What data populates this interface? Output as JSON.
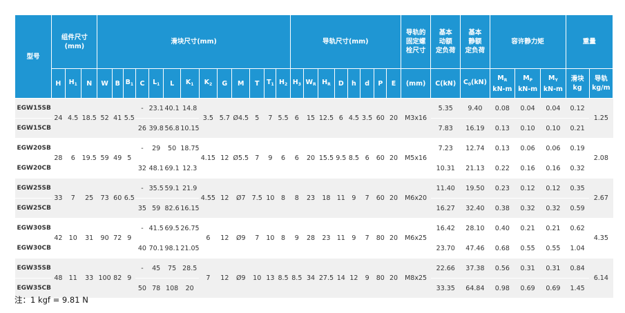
{
  "headers": {
    "model": "型号",
    "assembly": "组件尺寸\n(mm)",
    "block": "滑块尺寸(mm)",
    "rail": "导轨尺寸(mm)",
    "bolt": "导轨的\n固定螺\n栓尺寸",
    "dyn": "基本\n动额\n定负荷",
    "stat": "基本\n静额\n定负荷",
    "moment": "容许静力矩",
    "weight": "重量",
    "mm": "(mm)",
    "c_unit": "C(kN)",
    "c0_unit": "C0(kN)",
    "mr": "MR",
    "mp": "MP",
    "my": "MY",
    "slider": "滑块",
    "railw": "导轨",
    "knm": "kN-m",
    "kg": "kg",
    "kgm": "kg/m"
  },
  "dims": [
    "H",
    "H1",
    "N",
    "W",
    "B",
    "B1",
    "C",
    "L1",
    "L",
    "K1",
    "K2",
    "G",
    "M",
    "T",
    "T1",
    "H2",
    "H3",
    "WR",
    "HR",
    "D",
    "h",
    "d",
    "P",
    "E"
  ],
  "groups": [
    {
      "rows": [
        {
          "model": "EGW15SB",
          "C": "-",
          "L1": "23.1",
          "L": "40.1",
          "K1": "14.8",
          "C_kN": "5.35",
          "C0": "9.40",
          "MR": "0.08",
          "MP": "0.04",
          "MY": "0.04",
          "kg": "0.12"
        },
        {
          "model": "EGW15CB",
          "C": "26",
          "L1": "39.8",
          "L": "56.8",
          "K1": "10.15",
          "C_kN": "7.83",
          "C0": "16.19",
          "MR": "0.13",
          "MP": "0.10",
          "MY": "0.10",
          "kg": "0.21"
        }
      ],
      "shared": {
        "H": "24",
        "H1": "4.5",
        "N": "18.5",
        "W": "52",
        "B": "41",
        "B1": "5.5",
        "K2": "3.5",
        "G": "5.7",
        "M": "Ø4.5",
        "T": "5",
        "T1": "7",
        "H2": "5.5",
        "H3": "6",
        "WR": "15",
        "HR": "12.5",
        "D": "6",
        "h": "4.5",
        "d": "3.5",
        "P": "60",
        "E": "20",
        "bolt": "M3x16",
        "kgm": "1.25"
      }
    },
    {
      "rows": [
        {
          "model": "EGW20SB",
          "C": "-",
          "L1": "29",
          "L": "50",
          "K1": "18.75",
          "C_kN": "7.23",
          "C0": "12.74",
          "MR": "0.13",
          "MP": "0.06",
          "MY": "0.06",
          "kg": "0.19"
        },
        {
          "model": "EGW20CB",
          "C": "32",
          "L1": "48.1",
          "L": "69.1",
          "K1": "12.3",
          "C_kN": "10.31",
          "C0": "21.13",
          "MR": "0.22",
          "MP": "0.16",
          "MY": "0.16",
          "kg": "0.32"
        }
      ],
      "shared": {
        "H": "28",
        "H1": "6",
        "N": "19.5",
        "W": "59",
        "B": "49",
        "B1": "5",
        "K2": "4.15",
        "G": "12",
        "M": "Ø5.5",
        "T": "7",
        "T1": "9",
        "H2": "6",
        "H3": "6",
        "WR": "20",
        "HR": "15.5",
        "D": "9.5",
        "h": "8.5",
        "d": "6",
        "P": "60",
        "E": "20",
        "bolt": "M5x16",
        "kgm": "2.08"
      }
    },
    {
      "rows": [
        {
          "model": "EGW25SB",
          "C": "-",
          "L1": "35.5",
          "L": "59.1",
          "K1": "21.9",
          "C_kN": "11.40",
          "C0": "19.50",
          "MR": "0.23",
          "MP": "0.12",
          "MY": "0.12",
          "kg": "0.35"
        },
        {
          "model": "EGW25CB",
          "C": "35",
          "L1": "59",
          "L": "82.6",
          "K1": "16.15",
          "C_kN": "16.27",
          "C0": "32.40",
          "MR": "0.38",
          "MP": "0.32",
          "MY": "0.32",
          "kg": "0.59"
        }
      ],
      "shared": {
        "H": "33",
        "H1": "7",
        "N": "25",
        "W": "73",
        "B": "60",
        "B1": "6.5",
        "K2": "4.55",
        "G": "12",
        "M": "Ø7",
        "T": "7.5",
        "T1": "10",
        "H2": "8",
        "H3": "8",
        "WR": "23",
        "HR": "18",
        "D": "11",
        "h": "9",
        "d": "7",
        "P": "60",
        "E": "20",
        "bolt": "M6x20",
        "kgm": "2.67"
      }
    },
    {
      "rows": [
        {
          "model": "EGW30SB",
          "C": "-",
          "L1": "41.5",
          "L": "69.5",
          "K1": "26.75",
          "C_kN": "16.42",
          "C0": "28.10",
          "MR": "0.40",
          "MP": "0.21",
          "MY": "0.21",
          "kg": "0.62"
        },
        {
          "model": "EGW30CB",
          "C": "40",
          "L1": "70.1",
          "L": "98.1",
          "K1": "21.05",
          "C_kN": "23.70",
          "C0": "47.46",
          "MR": "0.68",
          "MP": "0.55",
          "MY": "0.55",
          "kg": "1.04"
        }
      ],
      "shared": {
        "H": "42",
        "H1": "10",
        "N": "31",
        "W": "90",
        "B": "72",
        "B1": "9",
        "K2": "6",
        "G": "12",
        "M": "Ø9",
        "T": "7",
        "T1": "10",
        "H2": "8",
        "H3": "9",
        "WR": "28",
        "HR": "23",
        "D": "11",
        "h": "9",
        "d": "7",
        "P": "80",
        "E": "20",
        "bolt": "M6x25",
        "kgm": "4.35"
      }
    },
    {
      "rows": [
        {
          "model": "EGW35SB",
          "C": "-",
          "L1": "45",
          "L": "75",
          "K1": "28.5",
          "C_kN": "22.66",
          "C0": "37.38",
          "MR": "0.56",
          "MP": "0.31",
          "MY": "0.31",
          "kg": "0.84"
        },
        {
          "model": "EGW35CB",
          "C": "50",
          "L1": "78",
          "L": "108",
          "K1": "20",
          "C_kN": "33.35",
          "C0": "64.84",
          "MR": "0.98",
          "MP": "0.69",
          "MY": "0.69",
          "kg": "1.45"
        }
      ],
      "shared": {
        "H": "48",
        "H1": "11",
        "N": "33",
        "W": "100",
        "B": "82",
        "B1": "9",
        "K2": "7",
        "G": "12",
        "M": "Ø9",
        "T": "10",
        "T1": "13",
        "H2": "8.5",
        "H3": "8.5",
        "WR": "34",
        "HR": "27.5",
        "D": "14",
        "h": "12",
        "d": "9",
        "P": "80",
        "E": "20",
        "bolt": "M8x25",
        "kgm": "6.14"
      }
    }
  ],
  "note": "注：1 kgf = 9.81 N"
}
